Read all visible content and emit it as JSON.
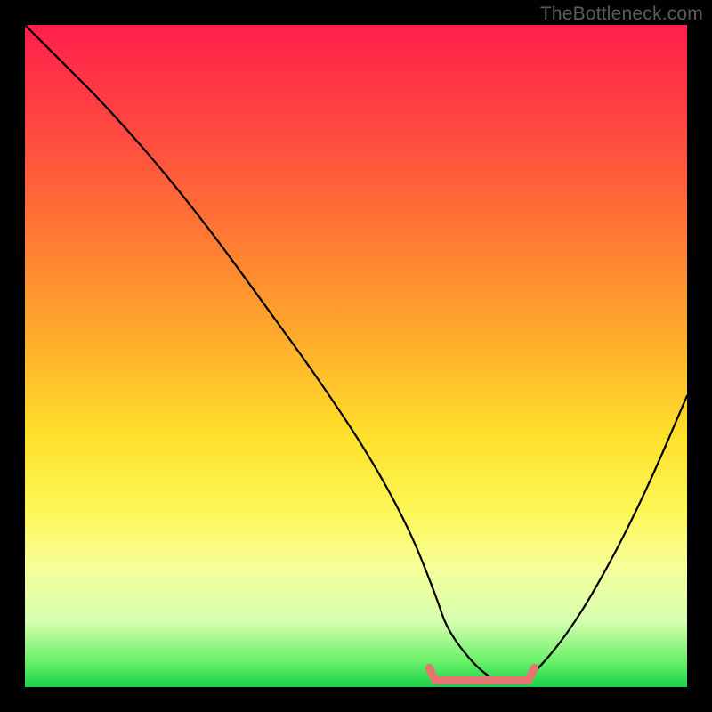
{
  "watermark": "TheBottleneck.com",
  "chart_data": {
    "type": "line",
    "title": "",
    "xlabel": "",
    "ylabel": "",
    "xlim": [
      0,
      100
    ],
    "ylim": [
      0,
      100
    ],
    "series": [
      {
        "name": "curve",
        "x": [
          0,
          6,
          12,
          20,
          28,
          36,
          44,
          52,
          58,
          62,
          64,
          70,
          74,
          76,
          82,
          88,
          94,
          100
        ],
        "values": [
          100,
          94,
          88,
          79,
          69,
          58,
          47,
          35,
          24,
          14,
          8,
          1,
          1,
          1,
          8,
          18,
          30,
          44
        ]
      }
    ],
    "highlight_segment": {
      "name": "flat-bottom",
      "x_start": 62,
      "x_end": 76,
      "y": 1,
      "color": "#e67470"
    },
    "background_gradient": [
      "#ff1f4b",
      "#ff4e3f",
      "#ff7a34",
      "#ffae2c",
      "#ffe02b",
      "#fdf85a",
      "#f6ff9a",
      "#d7ffb0",
      "#6cf06a",
      "#19d24a"
    ]
  }
}
